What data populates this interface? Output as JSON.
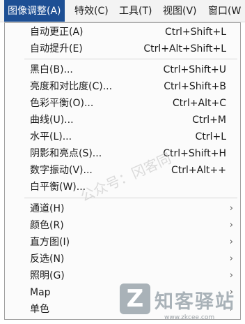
{
  "menubar": {
    "items": [
      "图像调整(A)",
      "特效(C)",
      "工具(T)",
      "视图(V)",
      "窗口(W"
    ]
  },
  "menu": {
    "groups": [
      [
        {
          "label": "自动更正(A)",
          "shortcut": "Ctrl+Shift+L"
        },
        {
          "label": "自动提升(E)",
          "shortcut": "Ctrl+Alt+Shift+L"
        }
      ],
      [
        {
          "label": "黑白(B)...",
          "shortcut": "Ctrl+Shift+U"
        },
        {
          "label": "亮度和对比度(C)...",
          "shortcut": "Ctrl+Shift+B"
        },
        {
          "label": "色彩平衡(O)...",
          "shortcut": "Ctrl+Alt+C"
        },
        {
          "label": "曲线(U)...",
          "shortcut": "Ctrl+M"
        },
        {
          "label": "水平(L)...",
          "shortcut": "Ctrl+L"
        },
        {
          "label": "阴影和亮点(S)...",
          "shortcut": "Ctrl+Shift+H"
        },
        {
          "label": "数字振动(V)...",
          "shortcut": "Ctrl+Alt++"
        },
        {
          "label": "白平衡(W)...",
          "shortcut": ""
        }
      ],
      [
        {
          "label": "通道(H)",
          "submenu": true
        },
        {
          "label": "颜色(R)",
          "submenu": true
        },
        {
          "label": "直方图(I)",
          "submenu": true
        },
        {
          "label": "反选(N)",
          "submenu": true
        },
        {
          "label": "照明(G)",
          "submenu": true
        },
        {
          "label": "Map",
          "submenu": true
        },
        {
          "label": "单色",
          "submenu": true
        }
      ]
    ],
    "submenu_arrow": "›"
  },
  "watermark": {
    "text": "公众号：冈客同",
    "logo_letter": "Z",
    "logo_name": "知客驿站",
    "logo_url": "www.zkcee.com"
  },
  "colors": {
    "menubar_active_bg": "#1d4f94",
    "menu_bg": "#fbfbfb"
  },
  "icons": {
    "submenu_arrow": "chevron-right-icon"
  }
}
